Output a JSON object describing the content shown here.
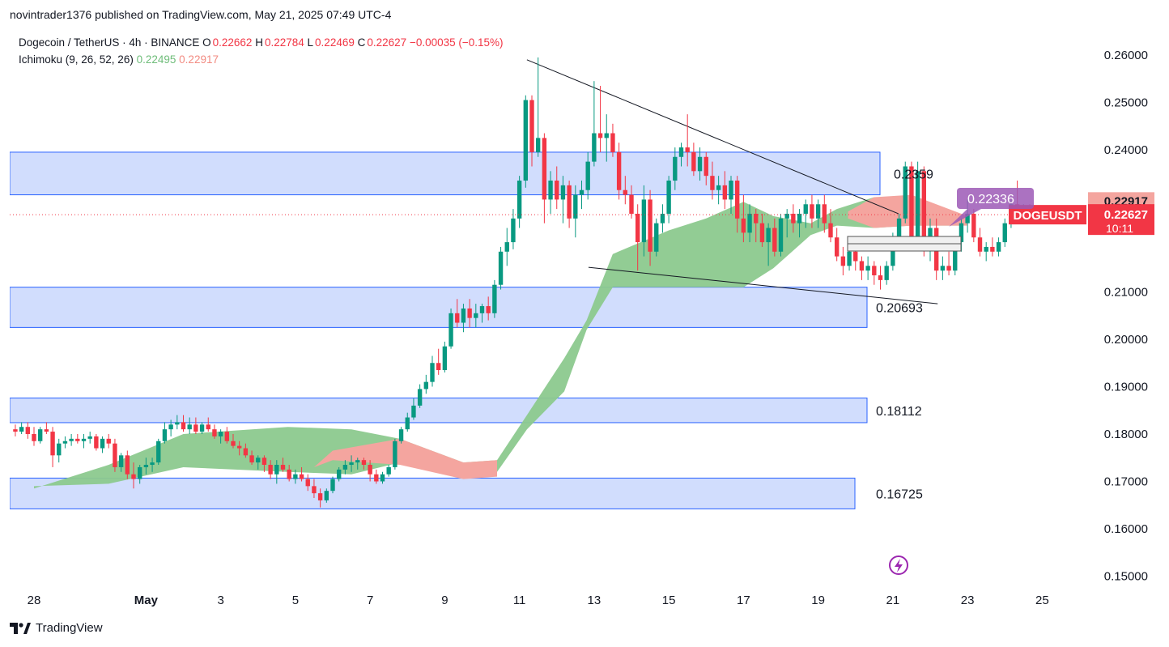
{
  "header": {
    "published": "novintrader1376 published on TradingView.com, May 21, 2025 07:49 UTC-4"
  },
  "legend": {
    "symbol": "Dogecoin / TetherUS · 4h · BINANCE",
    "o_label": "O",
    "o": "0.22662",
    "h_label": "H",
    "h": "0.22784",
    "l_label": "L",
    "l": "0.22469",
    "c_label": "C",
    "c": "0.22627",
    "change": "−0.00035 (−0.15%)",
    "indicator": "Ichimoku (9, 26, 52, 26)",
    "ind_v1": "0.22495",
    "ind_v2": "0.22917"
  },
  "footer": {
    "brand": "TradingView"
  },
  "colors": {
    "up": "#089981",
    "down": "#f23645",
    "cloud_green": "#8cc98e",
    "cloud_red": "#f4a59f",
    "zone_fill": "#d1ddfd",
    "zone_border": "#2962ff",
    "label_purple": "#9c59b6"
  },
  "chart_data": {
    "type": "candlestick",
    "symbol": "DOGEUSDT",
    "timeframe": "4h",
    "ylim": [
      0.15,
      0.26
    ],
    "y_ticks": [
      "0.26000",
      "0.25000",
      "0.24000",
      "0.22917",
      "0.22627",
      "0.22495",
      "0.21000",
      "0.20000",
      "0.19000",
      "0.18000",
      "0.17000",
      "0.16000",
      "0.15000"
    ],
    "x_ticks": [
      "28",
      "May",
      "3",
      "5",
      "7",
      "9",
      "11",
      "13",
      "15",
      "17",
      "19",
      "21",
      "23",
      "25"
    ],
    "price_label": {
      "symbol": "DOGEUSDT",
      "price": "0.22627",
      "countdown": "10:11"
    },
    "ichimoku_labels": {
      "span_a": "0.22917",
      "span_b": "0.22495"
    },
    "marker_label": "0.22336",
    "zones": [
      {
        "label": "0.2359",
        "low": 0.2305,
        "high": 0.2395
      },
      {
        "label": "0.20693",
        "low": 0.2025,
        "high": 0.211
      },
      {
        "label": "0.18112",
        "low": 0.1824,
        "high": 0.1876
      },
      {
        "label": "0.16725",
        "low": 0.1642,
        "high": 0.1707
      }
    ],
    "trendlines": [
      {
        "name": "upper",
        "from": [
          "May 11",
          0.259
        ],
        "to": [
          "May 21 12:00",
          0.2265
        ]
      },
      {
        "name": "lower",
        "from": [
          "May 12 20:00",
          0.2152
        ],
        "to": [
          "May 21",
          0.2075
        ]
      }
    ],
    "candles_start": "Apr 27 12:00",
    "candles": [
      [
        0.181,
        0.182,
        0.1795,
        0.1805
      ],
      [
        0.1805,
        0.1825,
        0.18,
        0.1815
      ],
      [
        0.1815,
        0.1825,
        0.179,
        0.18
      ],
      [
        0.18,
        0.1815,
        0.1775,
        0.1785
      ],
      [
        0.1785,
        0.1815,
        0.178,
        0.181
      ],
      [
        0.181,
        0.1825,
        0.18,
        0.1805
      ],
      [
        0.1805,
        0.1815,
        0.173,
        0.1755
      ],
      [
        0.1755,
        0.179,
        0.174,
        0.178
      ],
      [
        0.178,
        0.1795,
        0.177,
        0.1785
      ],
      [
        0.1785,
        0.18,
        0.1775,
        0.179
      ],
      [
        0.179,
        0.18,
        0.178,
        0.1785
      ],
      [
        0.1785,
        0.18,
        0.177,
        0.179
      ],
      [
        0.179,
        0.1805,
        0.178,
        0.1795
      ],
      [
        0.1795,
        0.18,
        0.1765,
        0.177
      ],
      [
        0.177,
        0.1795,
        0.176,
        0.179
      ],
      [
        0.179,
        0.18,
        0.177,
        0.178
      ],
      [
        0.178,
        0.179,
        0.172,
        0.173
      ],
      [
        0.173,
        0.176,
        0.172,
        0.1755
      ],
      [
        0.1755,
        0.1765,
        0.1705,
        0.1715
      ],
      [
        0.1715,
        0.174,
        0.1685,
        0.1705
      ],
      [
        0.1705,
        0.1735,
        0.1695,
        0.173
      ],
      [
        0.173,
        0.175,
        0.1715,
        0.1735
      ],
      [
        0.1735,
        0.175,
        0.172,
        0.174
      ],
      [
        0.174,
        0.179,
        0.1735,
        0.1785
      ],
      [
        0.1785,
        0.1825,
        0.178,
        0.181
      ],
      [
        0.181,
        0.183,
        0.1795,
        0.182
      ],
      [
        0.182,
        0.184,
        0.181,
        0.1825
      ],
      [
        0.1825,
        0.184,
        0.1805,
        0.181
      ],
      [
        0.181,
        0.1835,
        0.18,
        0.182
      ],
      [
        0.182,
        0.1835,
        0.18,
        0.1805
      ],
      [
        0.1805,
        0.1825,
        0.18,
        0.182
      ],
      [
        0.182,
        0.1835,
        0.1805,
        0.181
      ],
      [
        0.181,
        0.182,
        0.179,
        0.1795
      ],
      [
        0.1795,
        0.181,
        0.178,
        0.1805
      ],
      [
        0.1805,
        0.1815,
        0.178,
        0.1785
      ],
      [
        0.1785,
        0.18,
        0.177,
        0.1775
      ],
      [
        0.1775,
        0.1785,
        0.1755,
        0.177
      ],
      [
        0.177,
        0.178,
        0.175,
        0.1755
      ],
      [
        0.1755,
        0.1765,
        0.1735,
        0.174
      ],
      [
        0.174,
        0.1755,
        0.1725,
        0.175
      ],
      [
        0.175,
        0.1755,
        0.172,
        0.1735
      ],
      [
        0.1735,
        0.1745,
        0.1705,
        0.1715
      ],
      [
        0.1715,
        0.1745,
        0.1695,
        0.1735
      ],
      [
        0.1735,
        0.175,
        0.172,
        0.1725
      ],
      [
        0.1725,
        0.1735,
        0.17,
        0.1705
      ],
      [
        0.1705,
        0.1725,
        0.1695,
        0.1715
      ],
      [
        0.1715,
        0.173,
        0.17,
        0.1705
      ],
      [
        0.1705,
        0.1715,
        0.168,
        0.169
      ],
      [
        0.169,
        0.1705,
        0.1665,
        0.1675
      ],
      [
        0.1675,
        0.1685,
        0.1645,
        0.166
      ],
      [
        0.166,
        0.1685,
        0.1655,
        0.168
      ],
      [
        0.168,
        0.171,
        0.1675,
        0.1705
      ],
      [
        0.1705,
        0.173,
        0.17,
        0.1725
      ],
      [
        0.1725,
        0.1745,
        0.1715,
        0.1735
      ],
      [
        0.1735,
        0.1755,
        0.172,
        0.174
      ],
      [
        0.174,
        0.175,
        0.1725,
        0.1745
      ],
      [
        0.1745,
        0.175,
        0.1725,
        0.1735
      ],
      [
        0.1735,
        0.1745,
        0.17,
        0.1715
      ],
      [
        0.1715,
        0.1725,
        0.1695,
        0.17
      ],
      [
        0.17,
        0.172,
        0.1695,
        0.1715
      ],
      [
        0.1715,
        0.1735,
        0.171,
        0.173
      ],
      [
        0.173,
        0.179,
        0.1725,
        0.1785
      ],
      [
        0.1785,
        0.1815,
        0.178,
        0.181
      ],
      [
        0.181,
        0.1845,
        0.1805,
        0.1835
      ],
      [
        0.1835,
        0.1875,
        0.183,
        0.186
      ],
      [
        0.186,
        0.1905,
        0.1855,
        0.1895
      ],
      [
        0.1895,
        0.1925,
        0.1885,
        0.191
      ],
      [
        0.191,
        0.1965,
        0.19,
        0.195
      ],
      [
        0.195,
        0.198,
        0.1925,
        0.1935
      ],
      [
        0.1935,
        0.1995,
        0.193,
        0.1985
      ],
      [
        0.1985,
        0.2065,
        0.198,
        0.2055
      ],
      [
        0.2055,
        0.2085,
        0.2025,
        0.2035
      ],
      [
        0.2035,
        0.2075,
        0.2015,
        0.2065
      ],
      [
        0.2065,
        0.2085,
        0.2025,
        0.2045
      ],
      [
        0.2045,
        0.2075,
        0.2025,
        0.2055
      ],
      [
        0.2055,
        0.2075,
        0.2035,
        0.207
      ],
      [
        0.207,
        0.209,
        0.204,
        0.2055
      ],
      [
        0.2055,
        0.2125,
        0.2045,
        0.2115
      ],
      [
        0.2115,
        0.2195,
        0.2105,
        0.2185
      ],
      [
        0.2185,
        0.2235,
        0.2155,
        0.2205
      ],
      [
        0.2205,
        0.2275,
        0.219,
        0.2255
      ],
      [
        0.2255,
        0.2345,
        0.2235,
        0.2335
      ],
      [
        0.2335,
        0.2515,
        0.232,
        0.2505
      ],
      [
        0.2505,
        0.2515,
        0.2365,
        0.2395
      ],
      [
        0.2395,
        0.2595,
        0.2385,
        0.2425
      ],
      [
        0.2425,
        0.2435,
        0.2245,
        0.2295
      ],
      [
        0.2295,
        0.2355,
        0.2265,
        0.2335
      ],
      [
        0.2335,
        0.2365,
        0.2275,
        0.2295
      ],
      [
        0.2295,
        0.2345,
        0.2245,
        0.2325
      ],
      [
        0.2325,
        0.2335,
        0.2235,
        0.2255
      ],
      [
        0.2255,
        0.2325,
        0.2215,
        0.2305
      ],
      [
        0.2305,
        0.2335,
        0.2275,
        0.2315
      ],
      [
        0.2315,
        0.2395,
        0.2295,
        0.2375
      ],
      [
        0.2375,
        0.2545,
        0.2365,
        0.2435
      ],
      [
        0.2435,
        0.2535,
        0.2395,
        0.2425
      ],
      [
        0.2425,
        0.2475,
        0.2375,
        0.2435
      ],
      [
        0.2435,
        0.2455,
        0.2385,
        0.2395
      ],
      [
        0.2395,
        0.2415,
        0.2295,
        0.2315
      ],
      [
        0.2315,
        0.2345,
        0.2285,
        0.2305
      ],
      [
        0.2305,
        0.2325,
        0.2255,
        0.2265
      ],
      [
        0.2265,
        0.2285,
        0.2145,
        0.2205
      ],
      [
        0.2205,
        0.2325,
        0.2175,
        0.2295
      ],
      [
        0.2295,
        0.2315,
        0.2155,
        0.2185
      ],
      [
        0.2185,
        0.2255,
        0.2175,
        0.2245
      ],
      [
        0.2245,
        0.2285,
        0.2225,
        0.2265
      ],
      [
        0.2265,
        0.2345,
        0.2245,
        0.2335
      ],
      [
        0.2335,
        0.2405,
        0.2315,
        0.2385
      ],
      [
        0.2385,
        0.2415,
        0.2365,
        0.2405
      ],
      [
        0.2405,
        0.2475,
        0.2365,
        0.2395
      ],
      [
        0.2395,
        0.2415,
        0.2345,
        0.2355
      ],
      [
        0.2355,
        0.2405,
        0.2335,
        0.2385
      ],
      [
        0.2385,
        0.2395,
        0.2325,
        0.2345
      ],
      [
        0.2345,
        0.2375,
        0.2295,
        0.2315
      ],
      [
        0.2315,
        0.2345,
        0.2285,
        0.2325
      ],
      [
        0.2325,
        0.2355,
        0.2275,
        0.2295
      ],
      [
        0.2295,
        0.2345,
        0.2265,
        0.2335
      ],
      [
        0.2335,
        0.2345,
        0.2225,
        0.2255
      ],
      [
        0.2255,
        0.2305,
        0.2205,
        0.2225
      ],
      [
        0.2225,
        0.2285,
        0.2205,
        0.2265
      ],
      [
        0.2265,
        0.2275,
        0.2205,
        0.2245
      ],
      [
        0.2245,
        0.2265,
        0.2195,
        0.2205
      ],
      [
        0.2205,
        0.2245,
        0.2155,
        0.2235
      ],
      [
        0.2235,
        0.2255,
        0.2175,
        0.2185
      ],
      [
        0.2185,
        0.2265,
        0.2175,
        0.2255
      ],
      [
        0.2255,
        0.2275,
        0.2215,
        0.2265
      ],
      [
        0.2265,
        0.2285,
        0.2225,
        0.2245
      ],
      [
        0.2245,
        0.2275,
        0.2215,
        0.2265
      ],
      [
        0.2265,
        0.2295,
        0.2235,
        0.2285
      ],
      [
        0.2285,
        0.2305,
        0.2235,
        0.2255
      ],
      [
        0.2255,
        0.2295,
        0.2235,
        0.2285
      ],
      [
        0.2285,
        0.2305,
        0.2225,
        0.2245
      ],
      [
        0.2245,
        0.2275,
        0.2205,
        0.2215
      ],
      [
        0.2215,
        0.2235,
        0.2165,
        0.2175
      ],
      [
        0.2175,
        0.2195,
        0.2135,
        0.2155
      ],
      [
        0.2155,
        0.2195,
        0.2145,
        0.2185
      ],
      [
        0.2185,
        0.2205,
        0.2145,
        0.2165
      ],
      [
        0.2165,
        0.2175,
        0.2125,
        0.2145
      ],
      [
        0.2145,
        0.2175,
        0.2125,
        0.2155
      ],
      [
        0.2155,
        0.2165,
        0.2115,
        0.2135
      ],
      [
        0.2135,
        0.2155,
        0.2105,
        0.2125
      ],
      [
        0.2125,
        0.2165,
        0.2115,
        0.2155
      ],
      [
        0.2155,
        0.2225,
        0.2145,
        0.2215
      ],
      [
        0.2215,
        0.2265,
        0.2195,
        0.2255
      ],
      [
        0.2255,
        0.2375,
        0.2245,
        0.2365
      ],
      [
        0.2365,
        0.2375,
        0.2195,
        0.2215
      ],
      [
        0.2215,
        0.2375,
        0.2205,
        0.2355
      ],
      [
        0.2355,
        0.2365,
        0.2175,
        0.2195
      ],
      [
        0.2195,
        0.2255,
        0.2165,
        0.2235
      ],
      [
        0.2235,
        0.2255,
        0.2125,
        0.2145
      ],
      [
        0.2145,
        0.2175,
        0.2125,
        0.2155
      ],
      [
        0.2155,
        0.2185,
        0.2135,
        0.2145
      ],
      [
        0.2145,
        0.2215,
        0.2135,
        0.2205
      ],
      [
        0.2205,
        0.2255,
        0.2185,
        0.2245
      ],
      [
        0.2245,
        0.2295,
        0.2225,
        0.2265
      ],
      [
        0.2265,
        0.2275,
        0.2205,
        0.2215
      ],
      [
        0.2215,
        0.2235,
        0.2175,
        0.2185
      ],
      [
        0.2185,
        0.2205,
        0.2165,
        0.2195
      ],
      [
        0.2195,
        0.2215,
        0.2175,
        0.2185
      ],
      [
        0.2185,
        0.2215,
        0.2175,
        0.2205
      ],
      [
        0.2205,
        0.2255,
        0.2195,
        0.2245
      ],
      [
        0.2245,
        0.2295,
        0.2235,
        0.2285
      ],
      [
        0.2285,
        0.2335,
        0.2255,
        0.2265
      ],
      [
        0.2265,
        0.2285,
        0.2245,
        0.2275
      ],
      [
        0.2275,
        0.2285,
        0.2245,
        0.2263
      ]
    ]
  }
}
